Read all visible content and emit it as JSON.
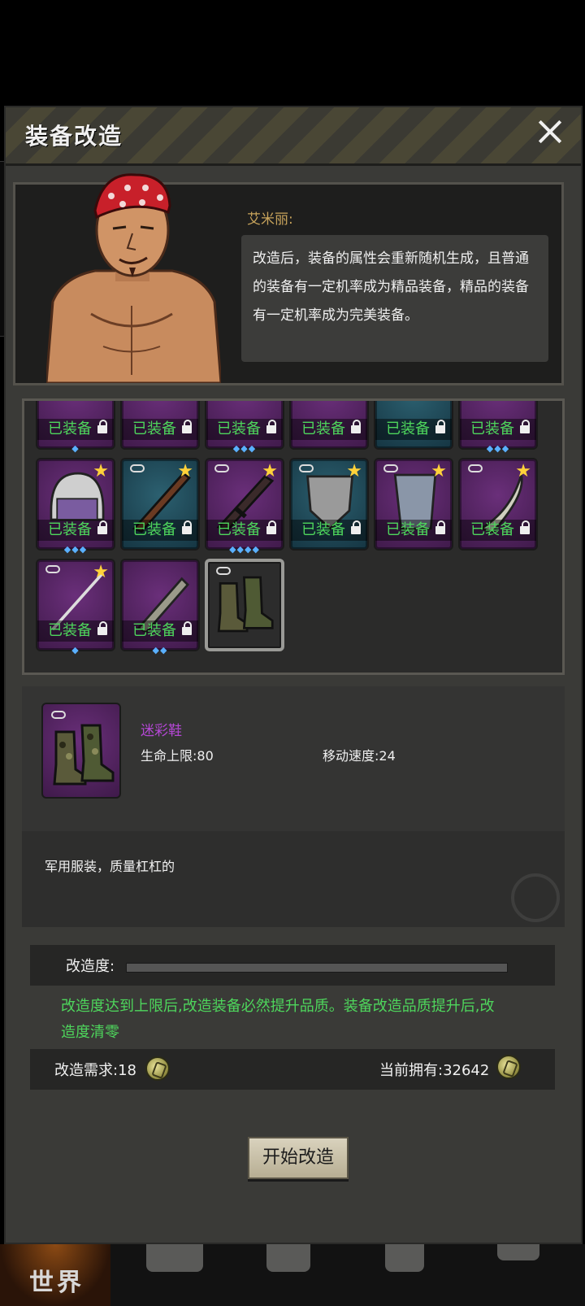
{
  "window": {
    "title": "装备改造",
    "close_icon": "close-icon"
  },
  "npc": {
    "name": "艾米丽:",
    "dialogue": "改造后，装备的属性会重新随机生成，且普通的装备有一定机率成为精品装备，精品的装备有一定机率成为完美装备。"
  },
  "inventory": {
    "equipped_label": "已装备",
    "rows": [
      [
        {
          "name": "top-item-1",
          "rarity": "purple",
          "equipped": true,
          "gems": "◆"
        },
        {
          "name": "top-item-2",
          "rarity": "purple",
          "equipped": true,
          "gems": ""
        },
        {
          "name": "top-item-3",
          "rarity": "purple",
          "equipped": true,
          "gems": "◆◆◆"
        },
        {
          "name": "top-item-4",
          "rarity": "purple",
          "equipped": true,
          "gems": ""
        },
        {
          "name": "top-item-5",
          "rarity": "blue",
          "equipped": true,
          "gems": ""
        },
        {
          "name": "top-item-6",
          "rarity": "purple",
          "equipped": true,
          "gems": "◆◆◆"
        }
      ],
      [
        {
          "name": "police-helmet",
          "rarity": "purple",
          "equipped": true,
          "star": true,
          "gems": "◆◆◆"
        },
        {
          "name": "rifle",
          "rarity": "blue",
          "equipped": true,
          "star": true,
          "linked": true,
          "gems": ""
        },
        {
          "name": "assault-rifle",
          "rarity": "purple",
          "equipped": true,
          "star": true,
          "linked": true,
          "gems": "◆◆◆◆"
        },
        {
          "name": "shield",
          "rarity": "blue",
          "equipped": true,
          "star": true,
          "linked": true,
          "gems": ""
        },
        {
          "name": "armor-plate",
          "rarity": "purple",
          "equipped": true,
          "star": true,
          "linked": true,
          "gems": ""
        },
        {
          "name": "machete",
          "rarity": "purple",
          "equipped": true,
          "star": true,
          "linked": true,
          "gems": ""
        }
      ],
      [
        {
          "name": "spear",
          "rarity": "purple",
          "equipped": true,
          "star": true,
          "linked": true,
          "gems": "◆"
        },
        {
          "name": "saw-blade",
          "rarity": "purple",
          "equipped": true,
          "star": false,
          "gems": "◆◆"
        },
        {
          "name": "camo-boots",
          "rarity": "selected",
          "equipped": false,
          "linked": true,
          "gems": ""
        }
      ]
    ]
  },
  "selected_item": {
    "name": "迷彩鞋",
    "stat_hp": "生命上限:80",
    "stat_speed": "移动速度:24",
    "description": "军用服装，质量杠杠的",
    "icon": "boots-icon"
  },
  "modification": {
    "progress_label": "改造度:",
    "progress": 0,
    "note": "改造度达到上限后,改造装备必然提升品质。装备改造品质提升后,改造度清零",
    "cost_label": "改造需求:18",
    "owned_label": "当前拥有:32642",
    "coin_icon": "coin-icon",
    "start_button": "开始改造"
  },
  "bottom_nav": {
    "world": "世界",
    "icons": [
      "bag-icon",
      "character-icon",
      "shop-icon",
      "vehicle-icon"
    ]
  },
  "colors": {
    "equipped_green": "#4ed65c",
    "rare_purple": "#6a2f7a",
    "uncommon_blue": "#2c6070",
    "name_purple": "#b347d3",
    "npc_name": "#c7a35b"
  }
}
